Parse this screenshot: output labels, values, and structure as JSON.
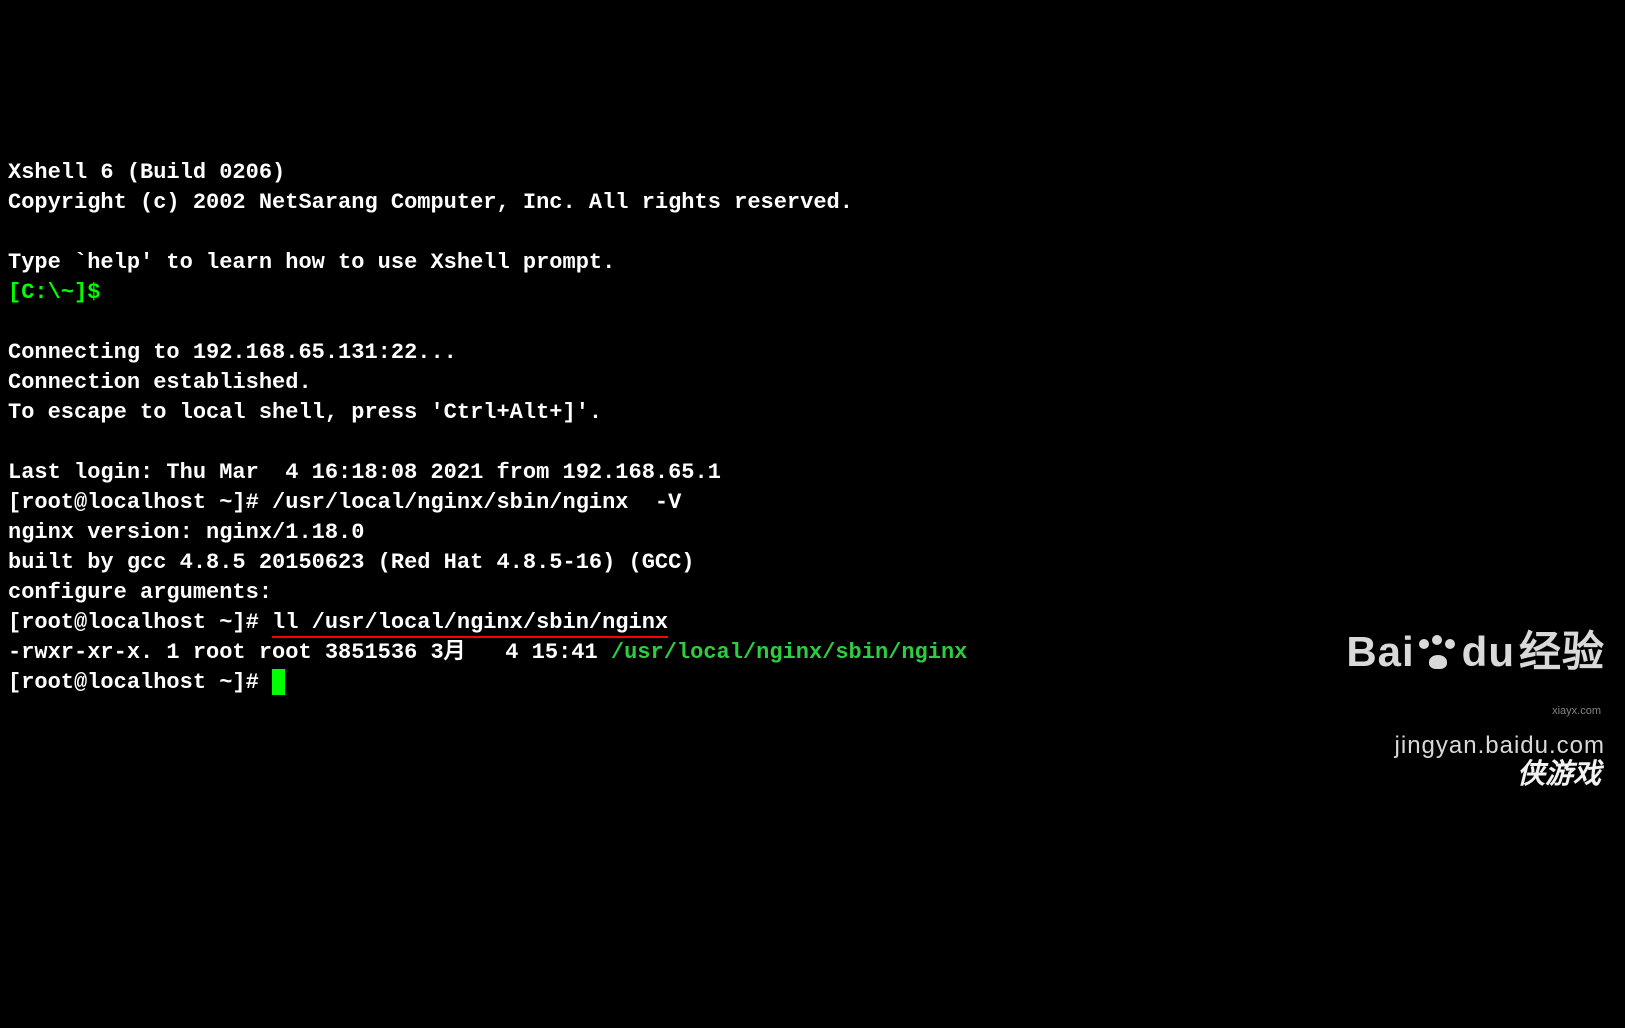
{
  "terminal": {
    "header1": "Xshell 6 (Build 0206)",
    "header2": "Copyright (c) 2002 NetSarang Computer, Inc. All rights reserved.",
    "help_line": "Type `help' to learn how to use Xshell prompt.",
    "local_prompt": "[C:\\~]$",
    "connecting": "Connecting to 192.168.65.131:22...",
    "connected": "Connection established.",
    "escape": "To escape to local shell, press 'Ctrl+Alt+]'.",
    "last_login": "Last login: Thu Mar  4 16:18:08 2021 from 192.168.65.1",
    "prompt1": "[root@localhost ~]# ",
    "cmd1": "/usr/local/nginx/sbin/nginx  -V",
    "nginx_v": "nginx version: nginx/1.18.0",
    "nginx_gcc": "built by gcc 4.8.5 20150623 (Red Hat 4.8.5-16) (GCC)",
    "nginx_conf": "configure arguments:",
    "prompt2": "[root@localhost ~]# ",
    "cmd2": "ll /usr/local/nginx/sbin/nginx",
    "ll_out_prefix": "-rwxr-xr-x. 1 root root 3851536 3月   4 15:41 ",
    "ll_out_path": "/usr/local/nginx/sbin/nginx",
    "prompt3": "[root@localhost ~]# "
  },
  "watermark": {
    "primary_1": "Bai",
    "primary_2": "du",
    "primary_3": "经验",
    "secondary": "jingyan.baidu.com",
    "small": "xiayx.com",
    "extra": "侠游戏"
  }
}
